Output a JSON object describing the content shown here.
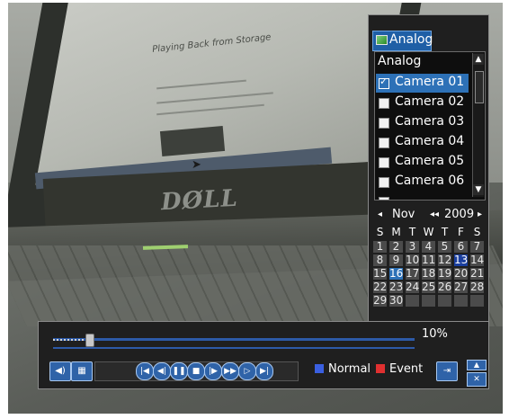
{
  "camera_panel": {
    "tab_label": "Analog",
    "list_header": "Analog",
    "cameras": [
      {
        "label": "Camera 01",
        "checked": true,
        "selected": true
      },
      {
        "label": "Camera 02",
        "checked": false,
        "selected": false
      },
      {
        "label": "Camera 03",
        "checked": false,
        "selected": false
      },
      {
        "label": "Camera 04",
        "checked": false,
        "selected": false
      },
      {
        "label": "Camera 05",
        "checked": false,
        "selected": false
      },
      {
        "label": "Camera 06",
        "checked": false,
        "selected": false
      }
    ]
  },
  "calendar": {
    "month": "Nov",
    "year": "2009",
    "weekdays": [
      "S",
      "M",
      "T",
      "W",
      "T",
      "F",
      "S"
    ],
    "days": [
      "1",
      "2",
      "3",
      "4",
      "5",
      "6",
      "7",
      "8",
      "9",
      "10",
      "11",
      "12",
      "13",
      "14",
      "15",
      "16",
      "17",
      "18",
      "19",
      "20",
      "21",
      "22",
      "23",
      "24",
      "25",
      "26",
      "27",
      "28",
      "29",
      "30"
    ],
    "first_weekday_index": 0,
    "today": "16",
    "marked_day": "13"
  },
  "playback": {
    "progress_label": "10%",
    "progress_percent": 10,
    "legend": [
      {
        "label": "Normal",
        "color": "#3a5fe0"
      },
      {
        "label": "Event",
        "color": "#e03030"
      }
    ]
  },
  "video": {
    "brand_text": "DØLL",
    "screen_title": "Playing Back from Storage"
  },
  "colors": {
    "accent": "#2d71b7",
    "panel_bg": "#1f1f1f"
  },
  "icons": [
    "speaker-icon",
    "clip-icon",
    "skip-start-icon",
    "rewind-icon",
    "pause-icon",
    "stop-icon",
    "step-forward-icon",
    "fast-forward-icon",
    "slow-forward-icon",
    "skip-end-icon",
    "exit-icon",
    "scroll-up-icon",
    "scroll-down-icon"
  ]
}
